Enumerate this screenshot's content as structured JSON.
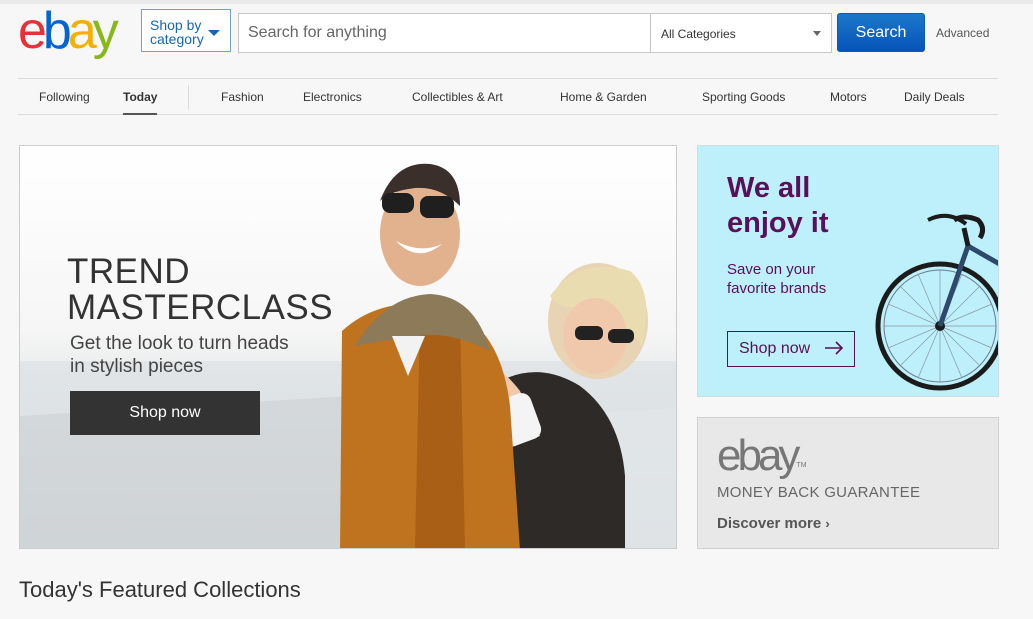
{
  "header": {
    "logo_letters": [
      "e",
      "b",
      "a",
      "y"
    ],
    "logo_colors": [
      "#e53238",
      "#0064d2",
      "#f5af02",
      "#86b817"
    ],
    "shop_by_category_label": "Shop by category",
    "search_placeholder": "Search for anything",
    "category_selected": "All Categories",
    "search_button_label": "Search",
    "advanced_label": "Advanced"
  },
  "nav": {
    "items": [
      {
        "label": "Following",
        "active": false
      },
      {
        "label": "Today",
        "active": true
      },
      {
        "label": "Fashion",
        "active": false
      },
      {
        "label": "Electronics",
        "active": false
      },
      {
        "label": "Collectibles & Art",
        "active": false
      },
      {
        "label": "Home & Garden",
        "active": false
      },
      {
        "label": "Sporting Goods",
        "active": false
      },
      {
        "label": "Motors",
        "active": false
      },
      {
        "label": "Daily Deals",
        "active": false
      }
    ]
  },
  "hero": {
    "title_line1": "TREND",
    "title_line2": "MASTERCLASS",
    "subtitle": "Get the look to turn heads in stylish pieces",
    "button_label": "Shop now"
  },
  "promo": {
    "title_line1": "We all",
    "title_line2": "enjoy it",
    "subtitle_line1": "Save on your",
    "subtitle_line2": "favorite brands",
    "button_label": "Shop now",
    "accent_color": "#5a0f59",
    "background_color": "#bdf0fa"
  },
  "money_back": {
    "logo_text": "ebay",
    "logo_tm": "TM",
    "guarantee_text": "MONEY BACK GUARANTEE",
    "link_label": "Discover more"
  },
  "featured": {
    "heading": "Today's Featured Collections"
  }
}
